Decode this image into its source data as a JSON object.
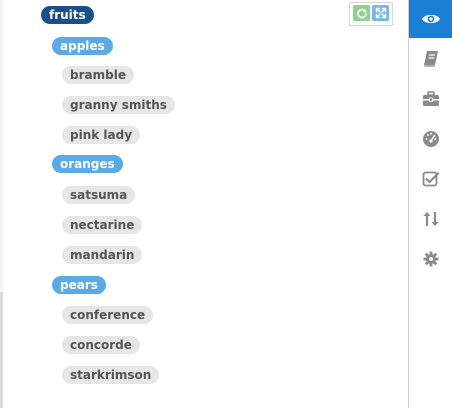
{
  "tree": {
    "root": "fruits",
    "categories": [
      {
        "label": "apples",
        "items": [
          "bramble",
          "granny smiths",
          "pink lady"
        ]
      },
      {
        "label": "oranges",
        "items": [
          "satsuma",
          "nectarine",
          "mandarin"
        ]
      },
      {
        "label": "pears",
        "items": [
          "conference",
          "concorde",
          "starkrimson"
        ]
      }
    ]
  },
  "toolbar": {
    "buttons": [
      "refresh-icon",
      "expand-icon"
    ]
  },
  "sidebar": {
    "items": [
      {
        "icon": "eye-icon",
        "active": true
      },
      {
        "icon": "book-icon",
        "active": false
      },
      {
        "icon": "briefcase-icon",
        "active": false
      },
      {
        "icon": "dashboard-icon",
        "active": false
      },
      {
        "icon": "checkbox-icon",
        "active": false
      },
      {
        "icon": "sort-arrows-icon",
        "active": false
      },
      {
        "icon": "gear-icon",
        "active": false
      }
    ]
  },
  "colors": {
    "root_tag": "#1a4f8f",
    "category_tag": "#5aaae8",
    "leaf_tag": "#e6e6e6",
    "sidebar_active": "#1b7fd6",
    "sidebar_icon": "#8a8a8a"
  }
}
